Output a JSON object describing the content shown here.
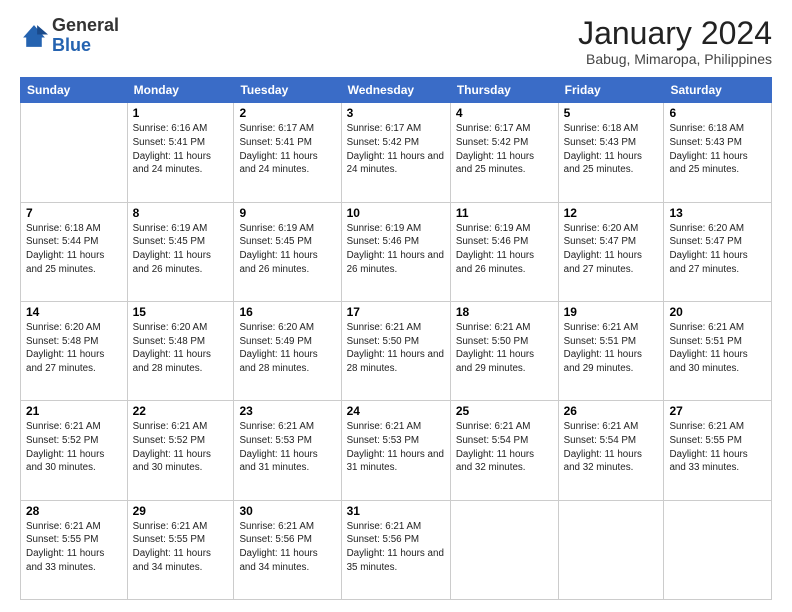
{
  "logo": {
    "general": "General",
    "blue": "Blue"
  },
  "header": {
    "month_title": "January 2024",
    "subtitle": "Babug, Mimaropa, Philippines"
  },
  "days_of_week": [
    "Sunday",
    "Monday",
    "Tuesday",
    "Wednesday",
    "Thursday",
    "Friday",
    "Saturday"
  ],
  "weeks": [
    [
      {
        "day": "",
        "sunrise": "",
        "sunset": "",
        "daylight": ""
      },
      {
        "day": "1",
        "sunrise": "Sunrise: 6:16 AM",
        "sunset": "Sunset: 5:41 PM",
        "daylight": "Daylight: 11 hours and 24 minutes."
      },
      {
        "day": "2",
        "sunrise": "Sunrise: 6:17 AM",
        "sunset": "Sunset: 5:41 PM",
        "daylight": "Daylight: 11 hours and 24 minutes."
      },
      {
        "day": "3",
        "sunrise": "Sunrise: 6:17 AM",
        "sunset": "Sunset: 5:42 PM",
        "daylight": "Daylight: 11 hours and 24 minutes."
      },
      {
        "day": "4",
        "sunrise": "Sunrise: 6:17 AM",
        "sunset": "Sunset: 5:42 PM",
        "daylight": "Daylight: 11 hours and 25 minutes."
      },
      {
        "day": "5",
        "sunrise": "Sunrise: 6:18 AM",
        "sunset": "Sunset: 5:43 PM",
        "daylight": "Daylight: 11 hours and 25 minutes."
      },
      {
        "day": "6",
        "sunrise": "Sunrise: 6:18 AM",
        "sunset": "Sunset: 5:43 PM",
        "daylight": "Daylight: 11 hours and 25 minutes."
      }
    ],
    [
      {
        "day": "7",
        "sunrise": "Sunrise: 6:18 AM",
        "sunset": "Sunset: 5:44 PM",
        "daylight": "Daylight: 11 hours and 25 minutes."
      },
      {
        "day": "8",
        "sunrise": "Sunrise: 6:19 AM",
        "sunset": "Sunset: 5:45 PM",
        "daylight": "Daylight: 11 hours and 26 minutes."
      },
      {
        "day": "9",
        "sunrise": "Sunrise: 6:19 AM",
        "sunset": "Sunset: 5:45 PM",
        "daylight": "Daylight: 11 hours and 26 minutes."
      },
      {
        "day": "10",
        "sunrise": "Sunrise: 6:19 AM",
        "sunset": "Sunset: 5:46 PM",
        "daylight": "Daylight: 11 hours and 26 minutes."
      },
      {
        "day": "11",
        "sunrise": "Sunrise: 6:19 AM",
        "sunset": "Sunset: 5:46 PM",
        "daylight": "Daylight: 11 hours and 26 minutes."
      },
      {
        "day": "12",
        "sunrise": "Sunrise: 6:20 AM",
        "sunset": "Sunset: 5:47 PM",
        "daylight": "Daylight: 11 hours and 27 minutes."
      },
      {
        "day": "13",
        "sunrise": "Sunrise: 6:20 AM",
        "sunset": "Sunset: 5:47 PM",
        "daylight": "Daylight: 11 hours and 27 minutes."
      }
    ],
    [
      {
        "day": "14",
        "sunrise": "Sunrise: 6:20 AM",
        "sunset": "Sunset: 5:48 PM",
        "daylight": "Daylight: 11 hours and 27 minutes."
      },
      {
        "day": "15",
        "sunrise": "Sunrise: 6:20 AM",
        "sunset": "Sunset: 5:48 PM",
        "daylight": "Daylight: 11 hours and 28 minutes."
      },
      {
        "day": "16",
        "sunrise": "Sunrise: 6:20 AM",
        "sunset": "Sunset: 5:49 PM",
        "daylight": "Daylight: 11 hours and 28 minutes."
      },
      {
        "day": "17",
        "sunrise": "Sunrise: 6:21 AM",
        "sunset": "Sunset: 5:50 PM",
        "daylight": "Daylight: 11 hours and 28 minutes."
      },
      {
        "day": "18",
        "sunrise": "Sunrise: 6:21 AM",
        "sunset": "Sunset: 5:50 PM",
        "daylight": "Daylight: 11 hours and 29 minutes."
      },
      {
        "day": "19",
        "sunrise": "Sunrise: 6:21 AM",
        "sunset": "Sunset: 5:51 PM",
        "daylight": "Daylight: 11 hours and 29 minutes."
      },
      {
        "day": "20",
        "sunrise": "Sunrise: 6:21 AM",
        "sunset": "Sunset: 5:51 PM",
        "daylight": "Daylight: 11 hours and 30 minutes."
      }
    ],
    [
      {
        "day": "21",
        "sunrise": "Sunrise: 6:21 AM",
        "sunset": "Sunset: 5:52 PM",
        "daylight": "Daylight: 11 hours and 30 minutes."
      },
      {
        "day": "22",
        "sunrise": "Sunrise: 6:21 AM",
        "sunset": "Sunset: 5:52 PM",
        "daylight": "Daylight: 11 hours and 30 minutes."
      },
      {
        "day": "23",
        "sunrise": "Sunrise: 6:21 AM",
        "sunset": "Sunset: 5:53 PM",
        "daylight": "Daylight: 11 hours and 31 minutes."
      },
      {
        "day": "24",
        "sunrise": "Sunrise: 6:21 AM",
        "sunset": "Sunset: 5:53 PM",
        "daylight": "Daylight: 11 hours and 31 minutes."
      },
      {
        "day": "25",
        "sunrise": "Sunrise: 6:21 AM",
        "sunset": "Sunset: 5:54 PM",
        "daylight": "Daylight: 11 hours and 32 minutes."
      },
      {
        "day": "26",
        "sunrise": "Sunrise: 6:21 AM",
        "sunset": "Sunset: 5:54 PM",
        "daylight": "Daylight: 11 hours and 32 minutes."
      },
      {
        "day": "27",
        "sunrise": "Sunrise: 6:21 AM",
        "sunset": "Sunset: 5:55 PM",
        "daylight": "Daylight: 11 hours and 33 minutes."
      }
    ],
    [
      {
        "day": "28",
        "sunrise": "Sunrise: 6:21 AM",
        "sunset": "Sunset: 5:55 PM",
        "daylight": "Daylight: 11 hours and 33 minutes."
      },
      {
        "day": "29",
        "sunrise": "Sunrise: 6:21 AM",
        "sunset": "Sunset: 5:55 PM",
        "daylight": "Daylight: 11 hours and 34 minutes."
      },
      {
        "day": "30",
        "sunrise": "Sunrise: 6:21 AM",
        "sunset": "Sunset: 5:56 PM",
        "daylight": "Daylight: 11 hours and 34 minutes."
      },
      {
        "day": "31",
        "sunrise": "Sunrise: 6:21 AM",
        "sunset": "Sunset: 5:56 PM",
        "daylight": "Daylight: 11 hours and 35 minutes."
      },
      {
        "day": "",
        "sunrise": "",
        "sunset": "",
        "daylight": ""
      },
      {
        "day": "",
        "sunrise": "",
        "sunset": "",
        "daylight": ""
      },
      {
        "day": "",
        "sunrise": "",
        "sunset": "",
        "daylight": ""
      }
    ]
  ]
}
